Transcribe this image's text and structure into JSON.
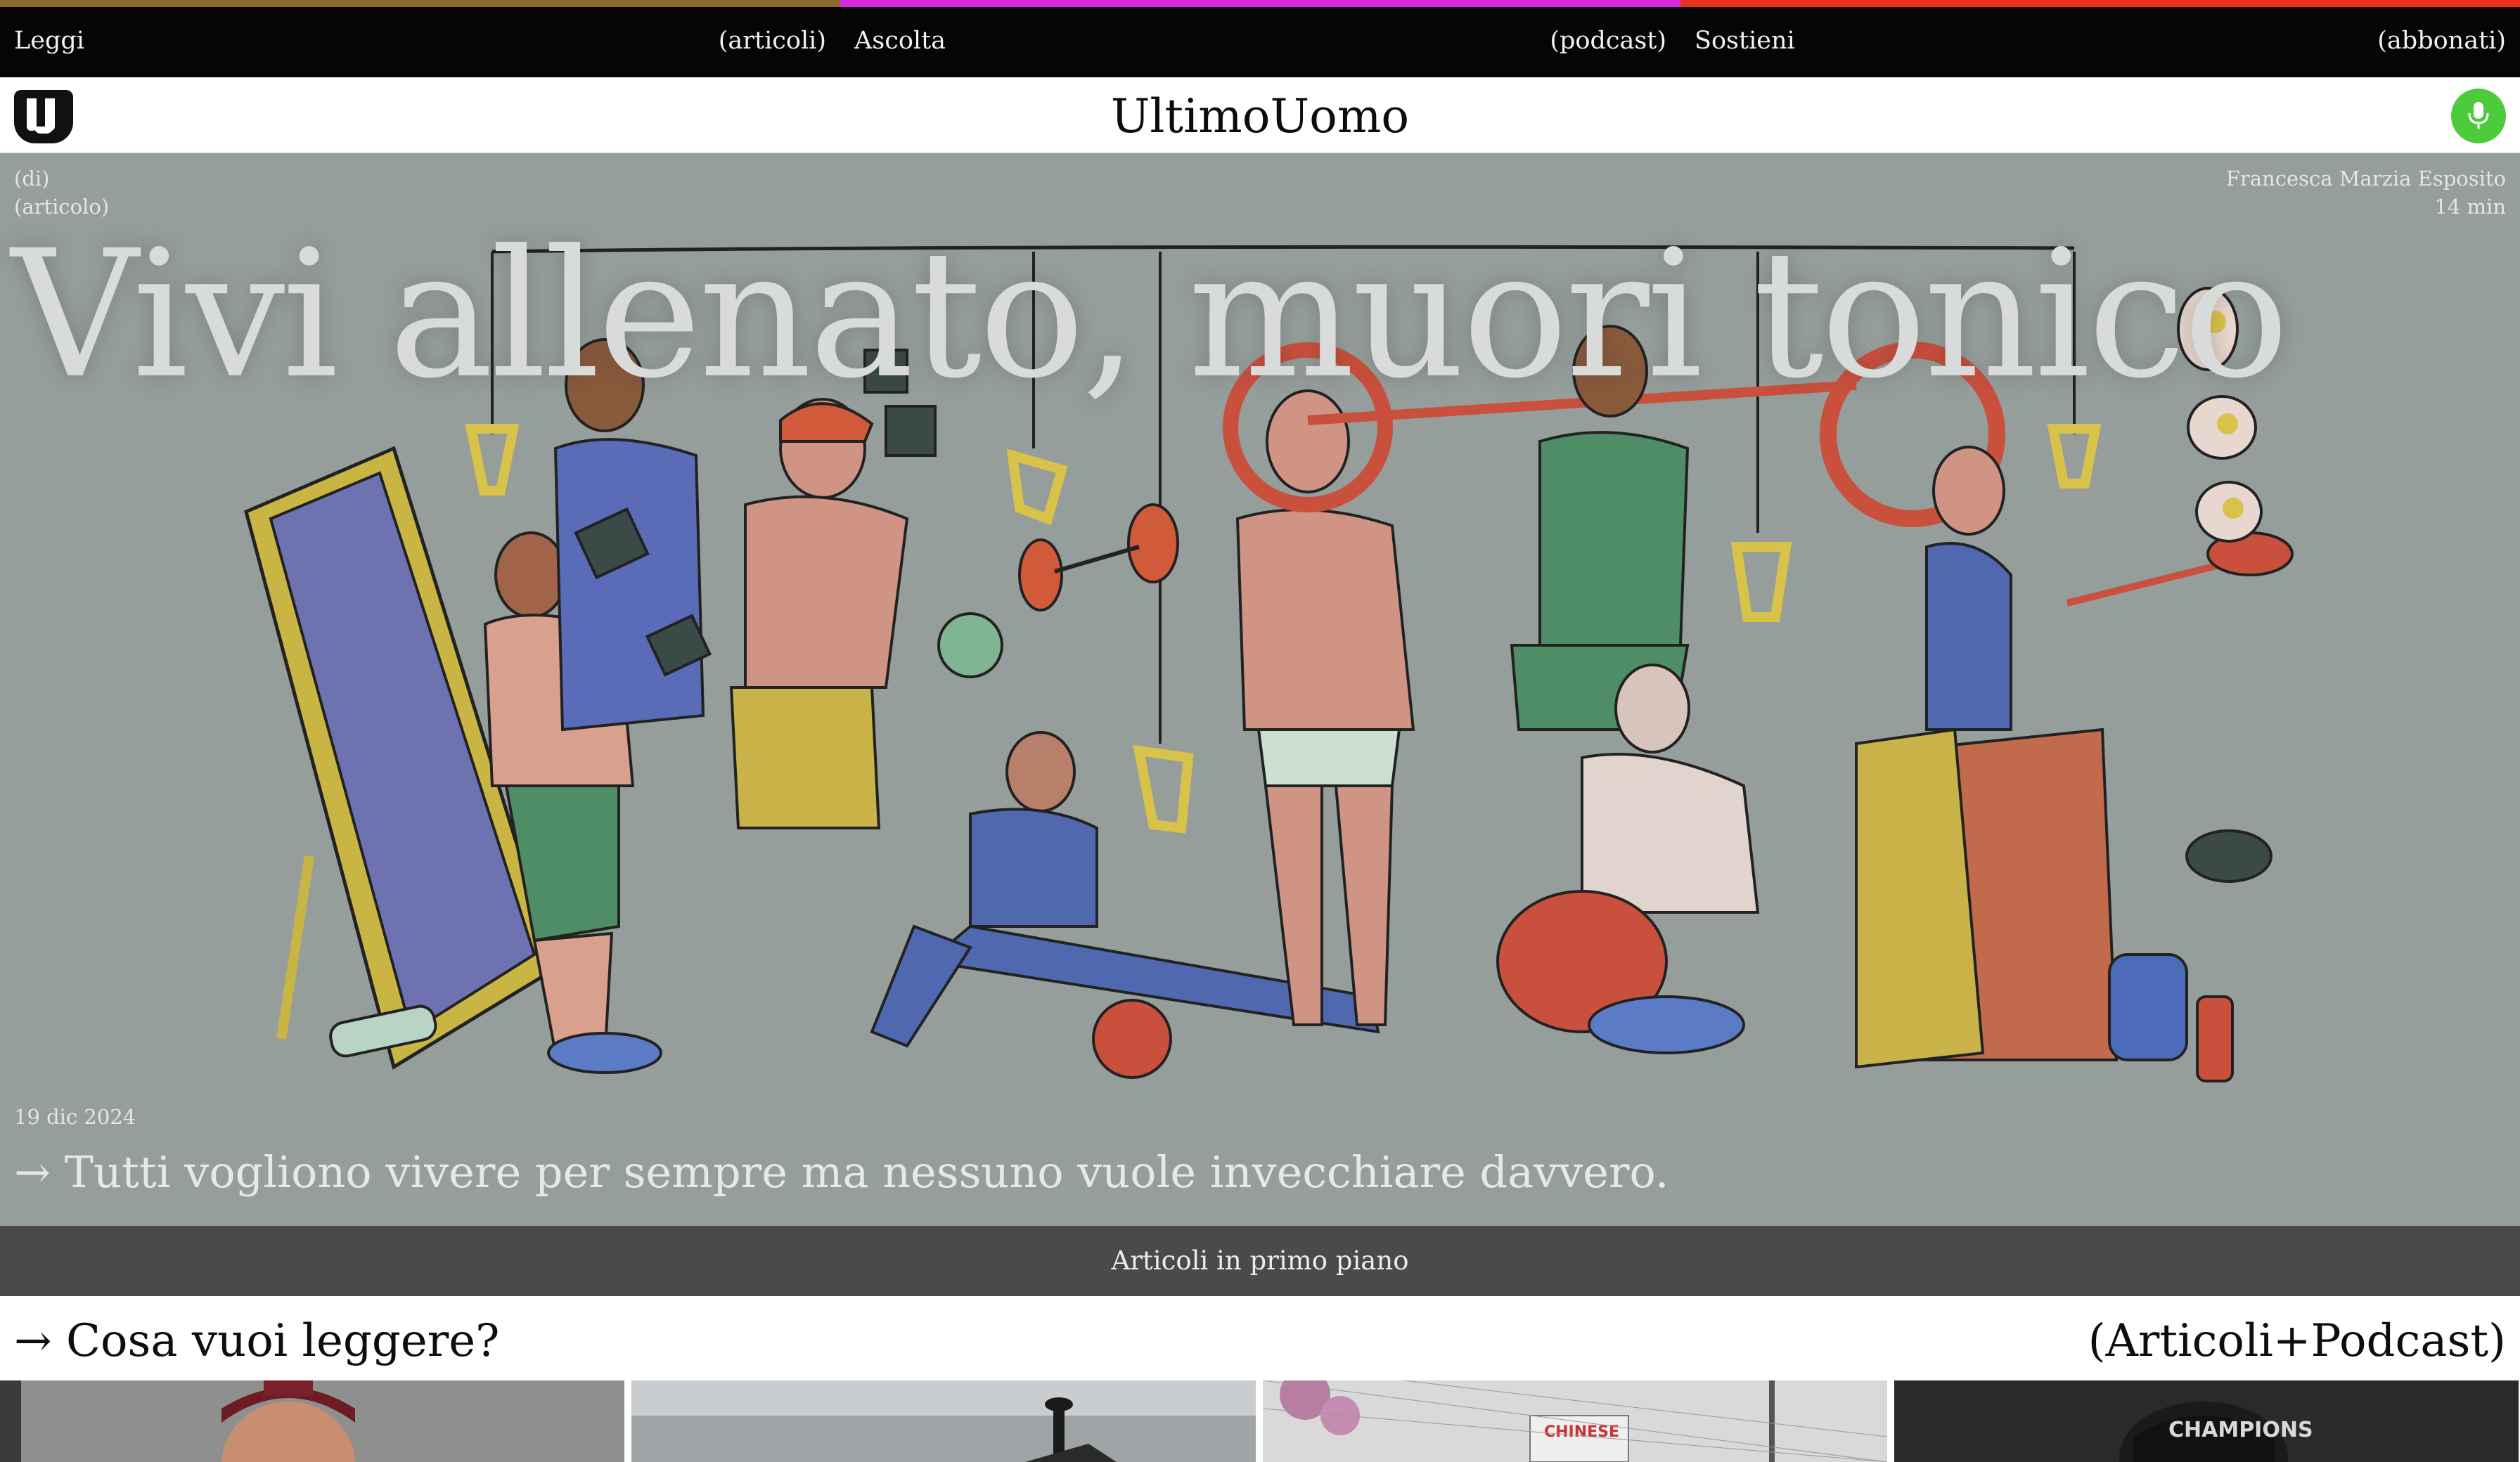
{
  "topnav": {
    "items": [
      {
        "label": "Leggi",
        "sub": "(articoli)",
        "color": "#8a6a2e"
      },
      {
        "label": "Ascolta",
        "sub": "(podcast)",
        "color": "#d62bd6"
      },
      {
        "label": "Sostieni",
        "sub": "(abbonati)",
        "color": "#e8321e"
      }
    ]
  },
  "header": {
    "logo_icon": "ultimouomo-logo-icon",
    "title": "UltimoUomo",
    "mic_icon": "microphone-icon",
    "mic_color": "#4ecb3c"
  },
  "hero": {
    "meta_left": {
      "line1": "(di)",
      "line2": "(articolo)"
    },
    "meta_right": {
      "author": "Francesca Marzia Esposito",
      "read_time": "14 min"
    },
    "title": "Vivi allenato, muori tonico",
    "date": "19 dic 2024",
    "subtitle": "→ Tutti vogliono vivere per sempre ma nessuno vuole invecchiare davvero.",
    "background_color": "#959e9a"
  },
  "featured": {
    "label": "Articoli in primo piano"
  },
  "section": {
    "left": "→ Cosa vuoi leggere?",
    "right": "(Articoli+Podcast)"
  },
  "cards": [
    {
      "icon": "coach-photo"
    },
    {
      "icon": "sea-photo"
    },
    {
      "icon": "fence-photo"
    },
    {
      "icon": "champions-photo"
    }
  ]
}
